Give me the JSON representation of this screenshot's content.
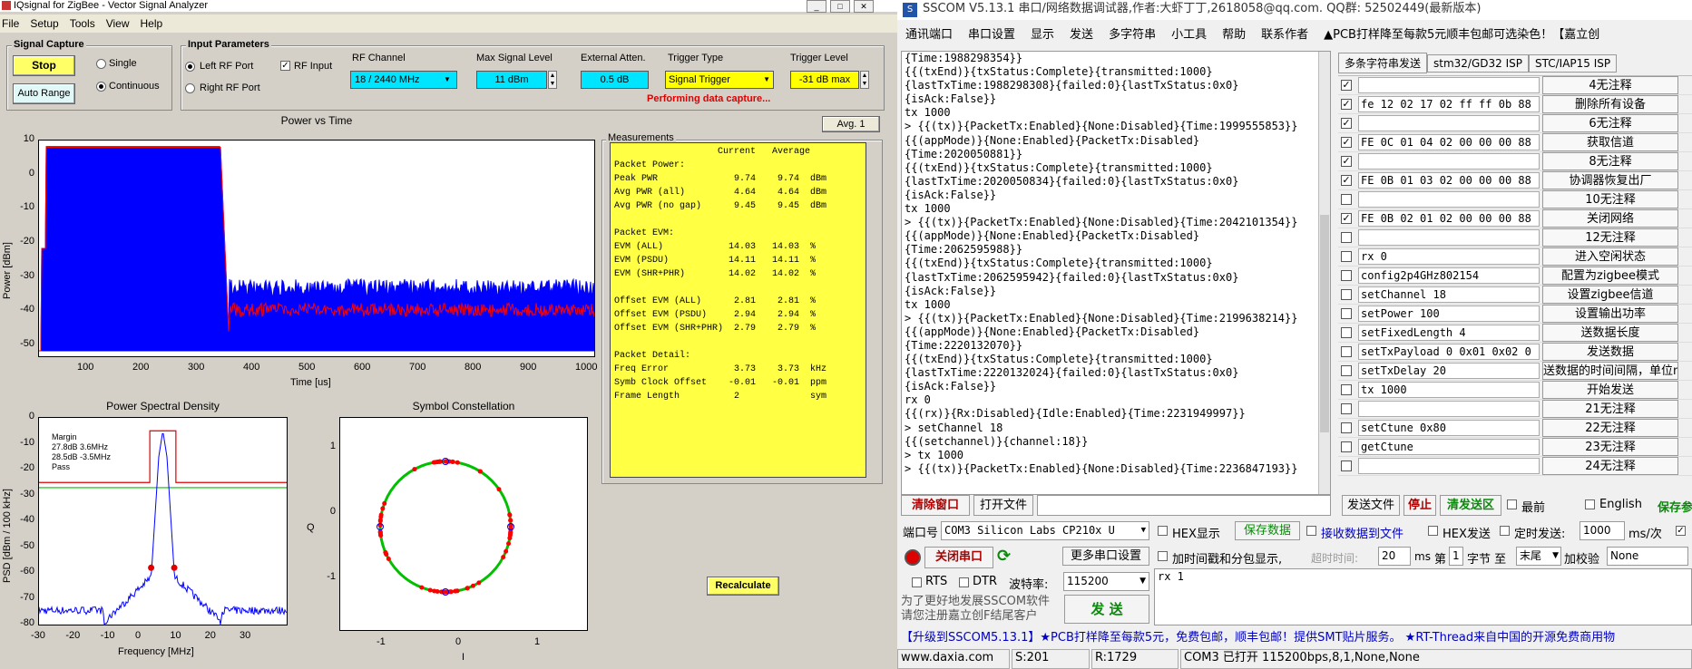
{
  "iq": {
    "title": "IQsignal for ZigBee - Vector Signal Analyzer",
    "menu": [
      "File",
      "Setup",
      "Tools",
      "View",
      "Help"
    ],
    "signal_capture": {
      "title": "Signal Capture",
      "stop": "Stop",
      "auto_range": "Auto Range",
      "single": "Single",
      "continuous": "Continuous"
    },
    "input_params": {
      "title": "Input Parameters",
      "left_rf": "Left RF Port",
      "right_rf": "Right RF Port",
      "rf_input": "RF Input",
      "rf_channel_label": "RF Channel",
      "rf_channel_value": "18  /  2440 MHz",
      "max_level_label": "Max Signal Level",
      "max_level_value": "11 dBm",
      "ext_atten_label": "External Atten.",
      "ext_atten_value": "0.5 dB",
      "trigger_type_label": "Trigger Type",
      "trigger_type_value": "Signal Trigger",
      "trigger_level_label": "Trigger Level",
      "trigger_level_value": "-31 dB max",
      "status": "Performing data capture..."
    },
    "avg_button": "Avg. 1",
    "recalculate": "Recalculate",
    "measurements_title": "Measurements",
    "measurements_text": "                   Current   Average\nPacket Power:\nPeak PWR              9.74    9.74  dBm\nAvg PWR (all)         4.64    4.64  dBm\nAvg PWR (no gap)      9.45    9.45  dBm\n\nPacket EVM:\nEVM (ALL)            14.03   14.03  %\nEVM (PSDU)           14.11   14.11  %\nEVM (SHR+PHR)        14.02   14.02  %\n\nOffset EVM (ALL)      2.81    2.81  %\nOffset EVM (PSDU)     2.94    2.94  %\nOffset EVM (SHR+PHR)  2.79    2.79  %\n\nPacket Detail:\nFreq Error            3.73    3.73  kHz\nSymb Clock Offset    -0.01   -0.01  ppm\nFrame Length          2             sym",
    "pvt": {
      "title": "Power vs Time",
      "xlabel": "Time [us]",
      "ylabel": "Power [dBm]",
      "yticks": [
        "10",
        "0",
        "-10",
        "-20",
        "-30",
        "-40",
        "-50"
      ],
      "xticks": [
        "100",
        "200",
        "300",
        "400",
        "500",
        "600",
        "700",
        "800",
        "900",
        "1000"
      ]
    },
    "psd": {
      "title": "Power Spectral Density",
      "xlabel": "Frequency [MHz]",
      "ylabel": "PSD [dBm / 100 kHz]",
      "yticks": [
        "0",
        "-10",
        "-20",
        "-30",
        "-40",
        "-50",
        "-60",
        "-70",
        "-80"
      ],
      "xticks": [
        "-30",
        "-20",
        "-10",
        "0",
        "10",
        "20",
        "30"
      ],
      "legend": [
        "Margin",
        "27.8dB  3.6MHz",
        "28.5dB  -3.5MHz",
        "Pass"
      ]
    },
    "const": {
      "title": "Symbol Constellation",
      "xlabel": "I",
      "ylabel": "Q",
      "yticks": [
        "1",
        "0",
        "-1"
      ],
      "xticks": [
        "-1",
        "0",
        "1"
      ]
    },
    "colors": {
      "trace_blue": "#0000ff",
      "trace_red": "#ff0000",
      "limit_green": "#00c000"
    }
  },
  "ss": {
    "title": "SSCOM V5.13.1 串口/网络数据调试器,作者:大虾丁丁,2618058@qq.com. QQ群: 52502449(最新版本)",
    "menu": [
      "通讯端口",
      "串口设置",
      "显示",
      "发送",
      "多字符串",
      "小工具",
      "帮助",
      "联系作者",
      "▲PCB打样降至每款5元顺丰包邮可选染色！【嘉立创"
    ],
    "terminal": "{Time:1988298354}}\n{{(txEnd)}{txStatus:Complete}{transmitted:1000}\n{lastTxTime:1988298308}{failed:0}{lastTxStatus:0x0}\n{isAck:False}}\ntx 1000\n> {{(tx)}{PacketTx:Enabled}{None:Disabled}{Time:1999555853}}\n{{(appMode)}{None:Enabled}{PacketTx:Disabled}\n{Time:2020050881}}\n{{(txEnd)}{txStatus:Complete}{transmitted:1000}\n{lastTxTime:2020050834}{failed:0}{lastTxStatus:0x0}\n{isAck:False}}\ntx 1000\n> {{(tx)}{PacketTx:Enabled}{None:Disabled}{Time:2042101354}}\n{{(appMode)}{None:Enabled}{PacketTx:Disabled}\n{Time:2062595988}}\n{{(txEnd)}{txStatus:Complete}{transmitted:1000}\n{lastTxTime:2062595942}{failed:0}{lastTxStatus:0x0}\n{isAck:False}}\ntx 1000\n> {{(tx)}{PacketTx:Enabled}{None:Disabled}{Time:2199638214}}\n{{(appMode)}{None:Enabled}{PacketTx:Disabled}\n{Time:2220132070}}\n{{(txEnd)}{txStatus:Complete}{transmitted:1000}\n{lastTxTime:2220132024}{failed:0}{lastTxStatus:0x0}\n{isAck:False}}\nrx 0\n{{(rx)}{Rx:Disabled}{Idle:Enabled}{Time:2231949997}}\n> setChannel 18\n{{(setchannel)}{channel:18}}\n> tx 1000\n> {{(tx)}{PacketTx:Enabled}{None:Disabled}{Time:2236847193}}",
    "tabs": [
      "多条字符串发送",
      "stm32/GD32 ISP",
      "STC/IAP15 ISP"
    ],
    "rows": [
      {
        "checked": true,
        "cmd": "",
        "btn": "4无注释"
      },
      {
        "checked": true,
        "cmd": "fe 12 02 17 02 ff ff 0b 88",
        "btn": "删除所有设备"
      },
      {
        "checked": true,
        "cmd": "",
        "btn": "6无注释"
      },
      {
        "checked": true,
        "cmd": "FE 0C 01 04 02 00 00 00 88",
        "btn": "获取信道"
      },
      {
        "checked": true,
        "cmd": "",
        "btn": "8无注释"
      },
      {
        "checked": true,
        "cmd": "FE 0B 01 03 02 00 00 00 88",
        "btn": "协调器恢复出厂"
      },
      {
        "checked": false,
        "cmd": "",
        "btn": "10无注释"
      },
      {
        "checked": true,
        "cmd": "FE 0B 02 01 02 00 00 00 88",
        "btn": "关闭网络"
      },
      {
        "checked": false,
        "cmd": "",
        "btn": "12无注释"
      },
      {
        "checked": false,
        "cmd": "rx 0",
        "btn": "进入空闲状态"
      },
      {
        "checked": false,
        "cmd": "config2p4GHz802154",
        "btn": "配置为zigbee模式"
      },
      {
        "checked": false,
        "cmd": "setChannel 18",
        "btn": "设置zigbee信道"
      },
      {
        "checked": false,
        "cmd": "setPower 100",
        "btn": "设置输出功率"
      },
      {
        "checked": false,
        "cmd": "setFixedLength 4",
        "btn": "送数据长度"
      },
      {
        "checked": false,
        "cmd": "setTxPayload 0  0x01 0x02 0",
        "btn": "发送数据"
      },
      {
        "checked": false,
        "cmd": "setTxDelay 20",
        "btn": "送数据的时间间隔，单位ms"
      },
      {
        "checked": false,
        "cmd": "tx 1000",
        "btn": "开始发送"
      },
      {
        "checked": false,
        "cmd": "",
        "btn": "21无注释"
      },
      {
        "checked": false,
        "cmd": "setCtune 0x80",
        "btn": "22无注释"
      },
      {
        "checked": false,
        "cmd": "getCtune",
        "btn": "23无注释"
      },
      {
        "checked": false,
        "cmd": "",
        "btn": "24无注释"
      }
    ],
    "clear_window": "清除窗口",
    "open_file": "打开文件",
    "send_file": "发送文件",
    "stop": "停止",
    "clear_send": "清发送区",
    "topmost": "最前",
    "english": "English",
    "save_param": "保存参数",
    "port_label": "端口号",
    "port_value": "COM3 Silicon Labs CP210x U",
    "hex_display": "HEX显示",
    "save_data": "保存数据",
    "recv_to_file": "接收数据到文件",
    "hex_send": "HEX发送",
    "timed_send": "定时发送:",
    "timed_value": "1000",
    "timed_unit": "ms/次",
    "close_port": "关闭串口",
    "more_settings": "更多串口设置",
    "timestamp": "加时间戳和分包显示,",
    "timeout_label": "超时时间:",
    "timeout_value": "20",
    "ms": "ms",
    "byte_label_pre": "第",
    "byte_value": "1",
    "byte_label_mid": "字节 至",
    "byte_end": "末尾",
    "checksum_label": "加校验",
    "checksum_value": "None",
    "rts": "RTS",
    "dtr": "DTR",
    "baud_label": "波特率:",
    "baud_value": "115200",
    "send_text": "rx 1",
    "promo": "为了更好地发展SSCOM软件\n请您注册嘉立创F结尾客户",
    "send": "发 送",
    "ticker": "【升级到SSCOM5.13.1】★PCB打样降至每款5元，免费包邮，顺丰包邮！提供SMT贴片服务。 ★RT-Thread来自中国的开源免费商用物",
    "status": {
      "url": "www.daxia.com",
      "s": "S:201",
      "r": "R:1729",
      "port": "COM3 已打开  115200bps,8,1,None,None"
    }
  }
}
